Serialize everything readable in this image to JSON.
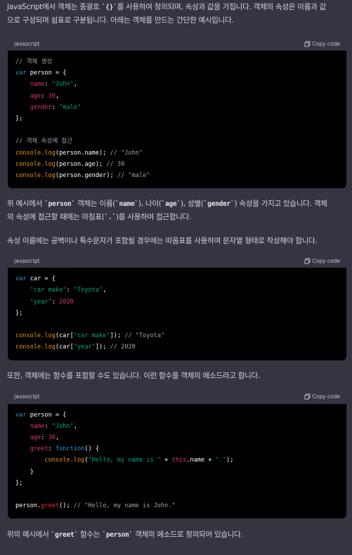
{
  "intro_line1": "JavaScript에서 객체는 중괄호 ",
  "intro_code": "`{}`",
  "intro_line1b": "를 사용하여 정의되며, 속성과 값을 가집니다. 객체의 속성은 이름과 값",
  "intro_line2": "으로 구성되며 쉼표로 구분됩니다. 아래는 객체를 만드는 간단한 예시입니다.",
  "code_lang": "javascript",
  "copy_label": "Copy code",
  "block1": {
    "c1": "// 객체 생성",
    "kw_var": "var",
    "person": "person",
    "name_key": "name",
    "name_val": "\"John\"",
    "age_key": "age",
    "age_val": "30",
    "gender_key": "gender",
    "gender_val": "\"male\"",
    "c2": "// 객체 속성에 접근",
    "log": "console.log",
    "r1": "(person.name);",
    "r1c": "// \"John\"",
    "r2": "(person.age);",
    "r2c": "// 30",
    "r3": "(person.gender);",
    "r3c": "// \"male\""
  },
  "para2_a": "위 예시에서 ",
  "para2_code1": "`person`",
  "para2_b": " 객체는 이름(",
  "para2_code2": "`name`",
  "para2_c": "), 나이(",
  "para2_code3": "`age`",
  "para2_d": "), 성별(",
  "para2_code4": "`gender`",
  "para2_e": ") 속성을 가지고 있습니다. 객체",
  "para2_line2a": "의 속성에 접근할 때에는 마침표(",
  "para2_code5": "`.`",
  "para2_line2b": ")를 사용하여 접근합니다.",
  "para3": "속성 이름에는 공백이나 특수문자가 포함될 경우에는 따옴표를 사용하여 문자열 형태로 작성해야 합니다.",
  "block2": {
    "car": "car",
    "k1": "\"car make\"",
    "v1": "\"Toyota\"",
    "k2": "\"year\"",
    "v2": "2020",
    "r1c": "// \"Toyota\"",
    "r2c": "// 2020"
  },
  "para4": "또한, 객체에는 함수를 포함할 수도 있습니다. 이런 함수를 객체의 메소드라고 합니다.",
  "block3": {
    "greet": "greet",
    "function_kw": "function",
    "hello": "\"Hello, my name is \"",
    "this_kw": "this",
    "dot_str": "\".\"",
    "call_c": "// \"Hello, my name is John.\""
  },
  "para5_a": "위의 예시에서 ",
  "para5_code1": "`greet`",
  "para5_b": " 함수는 ",
  "para5_code2": "`person`",
  "para5_c": " 객체의 메소드로 정의되어 있습니다."
}
